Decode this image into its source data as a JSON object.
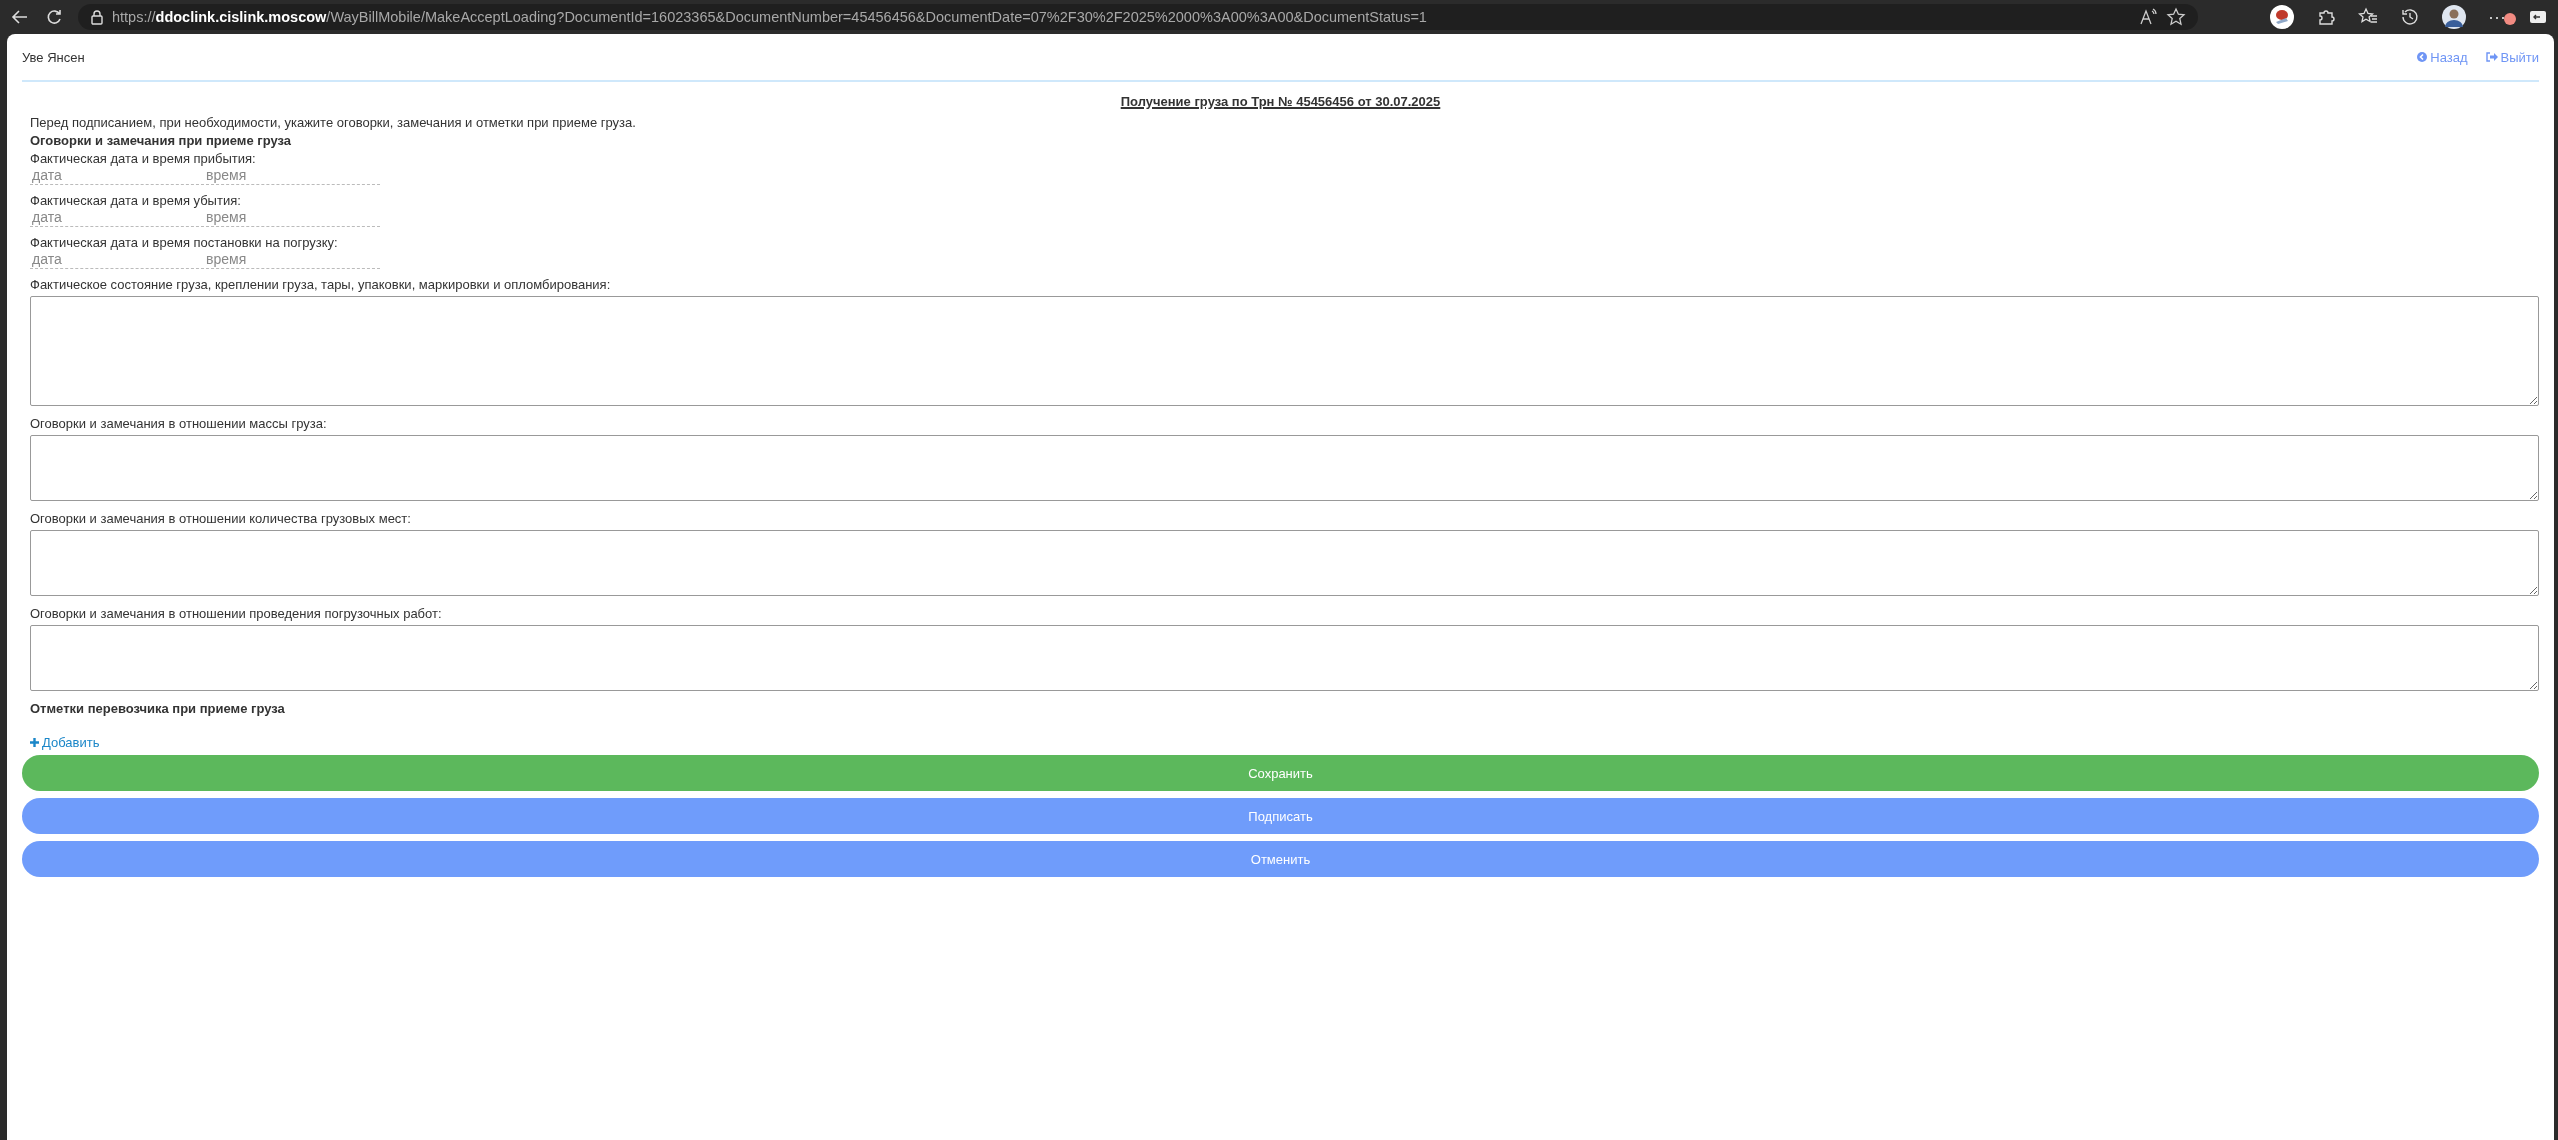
{
  "browser": {
    "url": "https://**ddoclink.cislink.moscow**/WayBillMobile/MakeAcceptLoading?DocumentId=16023365&DocumentNumber=45456456&DocumentDate=07%2F30%2F2025%2000%3A00%3A00&DocumentStatus=1",
    "menu": "···"
  },
  "header": {
    "user": "Уве Янсен",
    "back": "Назад",
    "logout": "Выйти"
  },
  "title": "Получение груза по Трн № 45456456 от 30.07.2025",
  "intro": "Перед подписанием, при необходимости, укажите оговорки, замечания и отметки при приеме груза.",
  "section_remarks": "Оговорки и замечания при приеме груза",
  "datetime_fields": [
    {
      "label": "Фактическая дата и время прибытия:",
      "date_placeholder": "дата",
      "time_placeholder": "время"
    },
    {
      "label": "Фактическая дата и время убытия:",
      "date_placeholder": "дата",
      "time_placeholder": "время"
    },
    {
      "label": "Фактическая дата и время постановки на погрузку:",
      "date_placeholder": "дата",
      "time_placeholder": "время"
    }
  ],
  "text_areas": [
    {
      "label": "Фактическое состояние груза, креплении груза, тары, упаковки, маркировки и опломбирования:",
      "kind": "large"
    },
    {
      "label": "Оговорки и замечания в отношении массы груза:",
      "kind": "small"
    },
    {
      "label": "Оговорки и замечания в отношении количества грузовых мест:",
      "kind": "small"
    },
    {
      "label": "Оговорки и замечания в отношении проведения погрузочных работ:",
      "kind": "small"
    }
  ],
  "section_carrier": "Отметки перевозчика при приеме груза",
  "add_link": "Добавить",
  "buttons": [
    {
      "label": "Сохранить",
      "kind": "save"
    },
    {
      "label": "Подписать",
      "kind": "primary"
    },
    {
      "label": "Отменить",
      "kind": "primary"
    }
  ]
}
